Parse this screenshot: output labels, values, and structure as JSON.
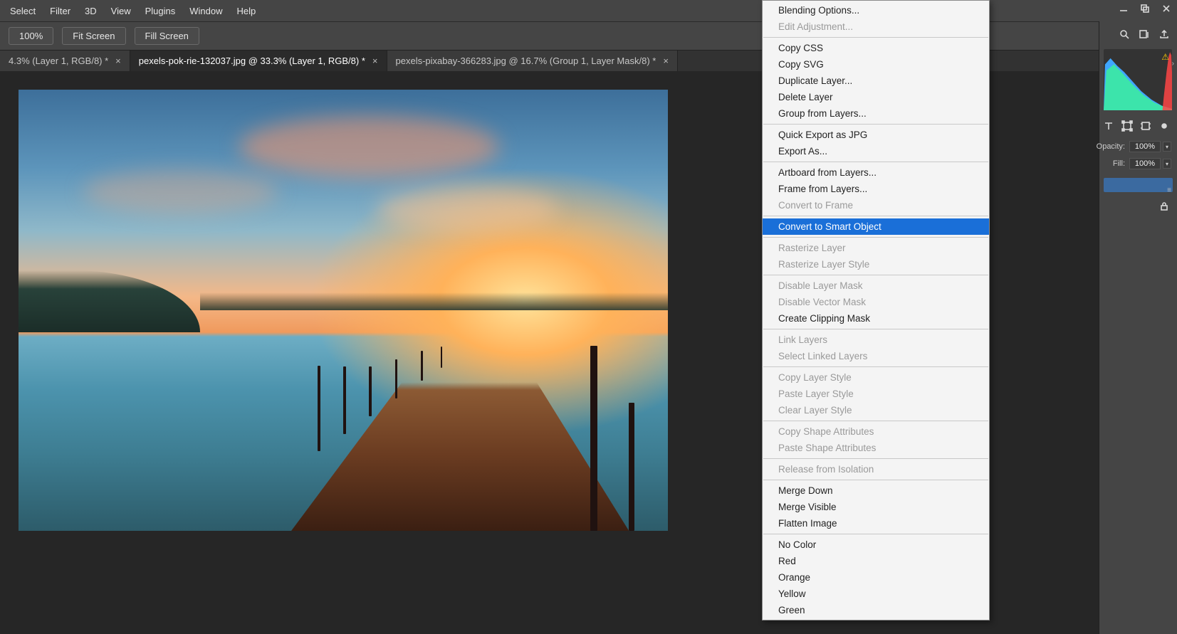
{
  "menubar": {
    "items": [
      "Select",
      "Filter",
      "3D",
      "View",
      "Plugins",
      "Window",
      "Help"
    ]
  },
  "toolbar": {
    "zoom": "100%",
    "fit_screen": "Fit Screen",
    "fill_screen": "Fill Screen"
  },
  "tabs": [
    {
      "label": "4.3% (Layer 1, RGB/8) *",
      "active": false
    },
    {
      "label": "pexels-pok-rie-132037.jpg @ 33.3% (Layer 1, RGB/8) *",
      "active": true
    },
    {
      "label": "pexels-pixabay-366283.jpg @ 16.7% (Group 1, Layer Mask/8) *",
      "active": false
    }
  ],
  "right_panel": {
    "opacity_label": "Opacity:",
    "opacity_value": "100%",
    "fill_label": "Fill:",
    "fill_value": "100%"
  },
  "context_menu": {
    "groups": [
      [
        {
          "label": "Blending Options..."
        },
        {
          "label": "Edit Adjustment...",
          "disabled": true
        }
      ],
      [
        {
          "label": "Copy CSS"
        },
        {
          "label": "Copy SVG"
        },
        {
          "label": "Duplicate Layer..."
        },
        {
          "label": "Delete Layer"
        },
        {
          "label": "Group from Layers..."
        }
      ],
      [
        {
          "label": "Quick Export as JPG"
        },
        {
          "label": "Export As..."
        }
      ],
      [
        {
          "label": "Artboard from Layers..."
        },
        {
          "label": "Frame from Layers..."
        },
        {
          "label": "Convert to Frame",
          "disabled": true
        }
      ],
      [
        {
          "label": "Convert to Smart Object",
          "selected": true
        }
      ],
      [
        {
          "label": "Rasterize Layer",
          "disabled": true
        },
        {
          "label": "Rasterize Layer Style",
          "disabled": true
        }
      ],
      [
        {
          "label": "Disable Layer Mask",
          "disabled": true
        },
        {
          "label": "Disable Vector Mask",
          "disabled": true
        },
        {
          "label": "Create Clipping Mask"
        }
      ],
      [
        {
          "label": "Link Layers",
          "disabled": true
        },
        {
          "label": "Select Linked Layers",
          "disabled": true
        }
      ],
      [
        {
          "label": "Copy Layer Style",
          "disabled": true
        },
        {
          "label": "Paste Layer Style",
          "disabled": true
        },
        {
          "label": "Clear Layer Style",
          "disabled": true
        }
      ],
      [
        {
          "label": "Copy Shape Attributes",
          "disabled": true
        },
        {
          "label": "Paste Shape Attributes",
          "disabled": true
        }
      ],
      [
        {
          "label": "Release from Isolation",
          "disabled": true
        }
      ],
      [
        {
          "label": "Merge Down"
        },
        {
          "label": "Merge Visible"
        },
        {
          "label": "Flatten Image"
        }
      ],
      [
        {
          "label": "No Color"
        },
        {
          "label": "Red"
        },
        {
          "label": "Orange"
        },
        {
          "label": "Yellow"
        },
        {
          "label": "Green"
        }
      ]
    ]
  }
}
